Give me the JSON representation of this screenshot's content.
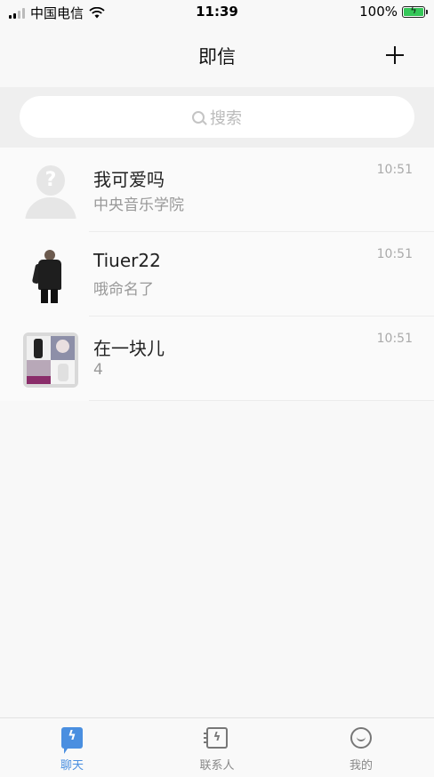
{
  "status_bar": {
    "carrier": "中国电信",
    "time": "11:39",
    "battery_percent": "100%"
  },
  "nav": {
    "title": "即信",
    "add_icon": "plus-icon"
  },
  "search": {
    "placeholder": "搜索",
    "icon": "search-icon"
  },
  "chats": [
    {
      "name": "我可爱吗",
      "preview": "中央音乐学院",
      "time": "10:51",
      "avatar": "default-user-avatar"
    },
    {
      "name": "Tiuer22",
      "preview": "哦命名了",
      "time": "10:51",
      "avatar": "person-photo-avatar"
    },
    {
      "name": "在一块儿",
      "preview": "4",
      "time": "10:51",
      "avatar": "group-collage-avatar"
    }
  ],
  "tabs": [
    {
      "label": "聊天",
      "icon": "chat-bubble-icon",
      "active": true
    },
    {
      "label": "联系人",
      "icon": "contacts-icon",
      "active": false
    },
    {
      "label": "我的",
      "icon": "smile-icon",
      "active": false
    }
  ],
  "colors": {
    "accent": "#4a8fe0",
    "background": "#f8f8f8",
    "battery_fill": "#35c759"
  }
}
